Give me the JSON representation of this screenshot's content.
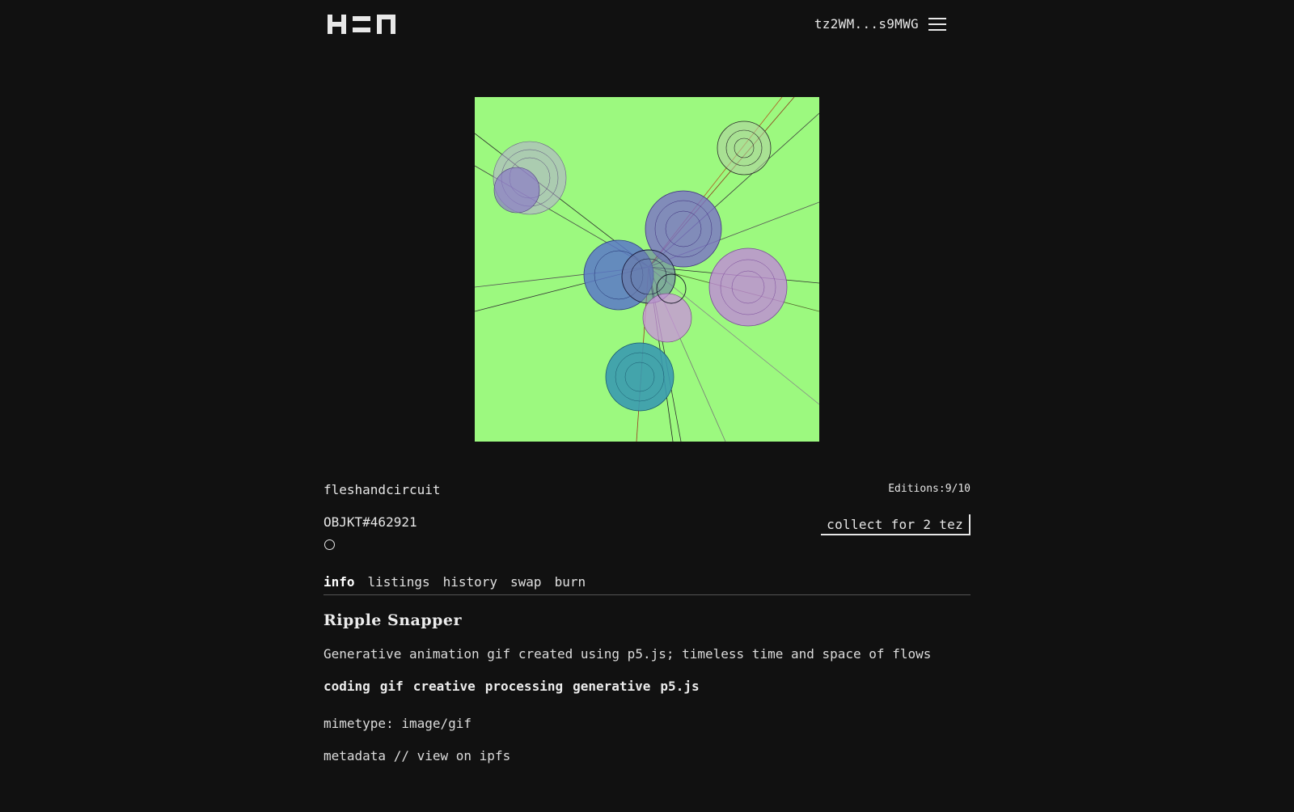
{
  "header": {
    "wallet_address": "tz2WM...s9MWG",
    "logo_icon": "hen-logo-icon",
    "menu_icon": "hamburger-menu-icon"
  },
  "artwork": {
    "background_color": "#9cf97f"
  },
  "details": {
    "creator": "fleshandcircuit",
    "editions_label": "Editions:",
    "editions_value": "9/10",
    "objkt": "OBJKT#462921",
    "collect_label": "collect for 2 tez"
  },
  "tabs": [
    {
      "label": "info",
      "active": true
    },
    {
      "label": "listings",
      "active": false
    },
    {
      "label": "history",
      "active": false
    },
    {
      "label": "swap",
      "active": false
    },
    {
      "label": "burn",
      "active": false
    }
  ],
  "info": {
    "title": "Ripple Snapper",
    "description": "Generative animation gif created using p5.js; timeless time and space of flows",
    "tags": [
      "coding",
      "gif",
      "creative",
      "processing",
      "generative",
      "p5.js"
    ],
    "mimetype_label": "mimetype:",
    "mimetype_value": "image/gif",
    "metadata_label": "metadata",
    "separator": "//",
    "ipfs_label": "view on ipfs"
  }
}
